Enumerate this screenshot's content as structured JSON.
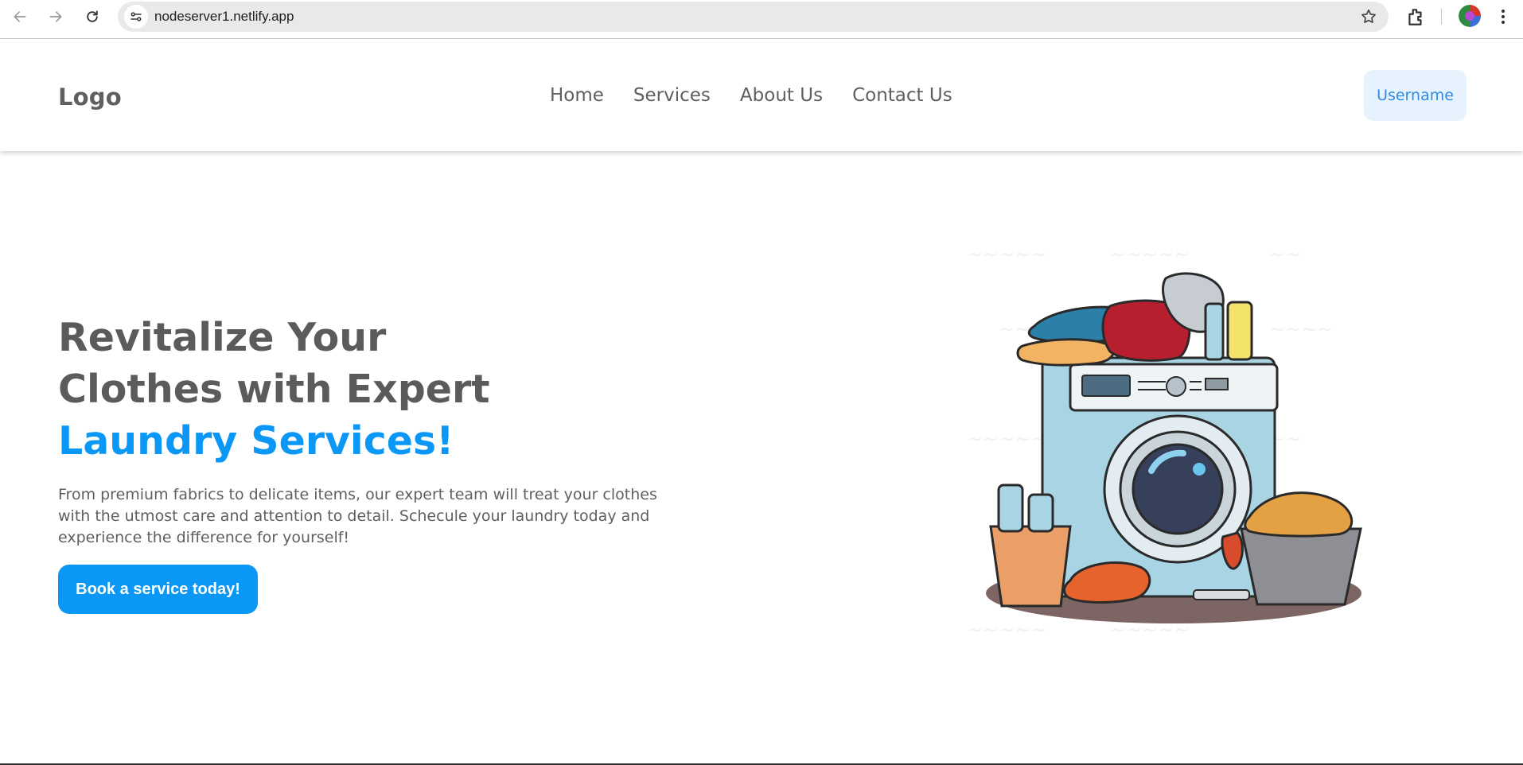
{
  "browser": {
    "url": "nodeserver1.netlify.app"
  },
  "header": {
    "logo": "Logo",
    "nav": [
      "Home",
      "Services",
      "About Us",
      "Contact Us"
    ],
    "user_button": "Username"
  },
  "hero": {
    "title_line1": "Revitalize Your",
    "title_line2": "Clothes with Expert",
    "title_accent": "Laundry Services!",
    "description": "From premium fabrics to delicate items, our expert team will treat your clothes with the utmost care and attention to detail. Schecule your laundry today and experience the difference for yourself!",
    "cta_label": "Book a service today!",
    "image_alt": "washing-machine-illustration"
  },
  "colors": {
    "accent": "#0a97f5",
    "text": "#5f5f5f",
    "user_button_bg": "#e6f3ff"
  }
}
